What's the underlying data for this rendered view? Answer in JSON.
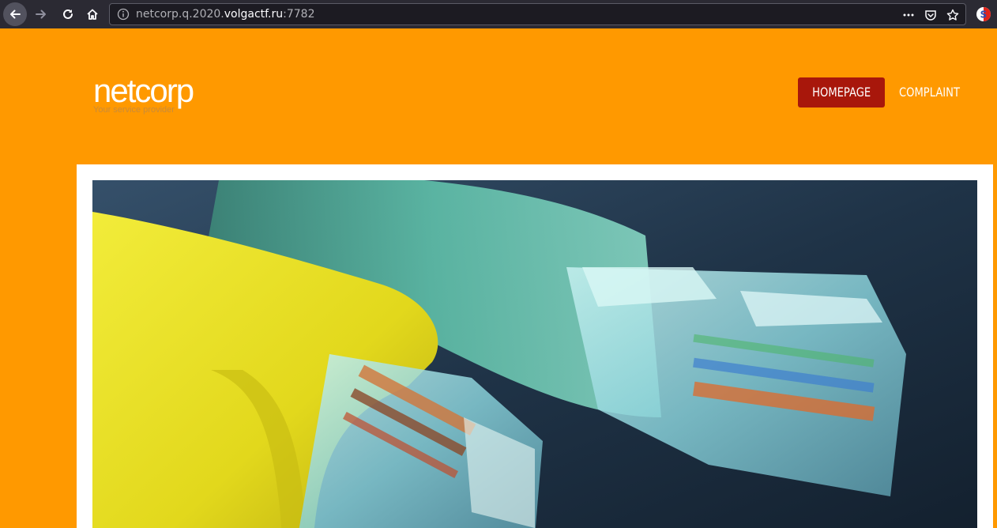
{
  "browser": {
    "url_prefix": "netcorp.q.2020.",
    "url_domain": "volgactf.ru",
    "url_suffix": ":7782",
    "icons": [
      "back-icon",
      "forward-icon",
      "reload-icon",
      "home-icon",
      "info-icon",
      "more-icon",
      "pocket-icon",
      "star-icon",
      "extension-icon"
    ]
  },
  "site": {
    "logo": "netcorp",
    "tagline": "Your service provider"
  },
  "nav": {
    "items": [
      {
        "label": "HOMEPAGE",
        "active": true
      },
      {
        "label": "COMPLAINT",
        "active": false
      }
    ]
  },
  "colors": {
    "page_bg": "#ff9900",
    "nav_active": "#a8170b",
    "content_bg": "#ffffff"
  },
  "hero": {
    "subject": "network-cables-photo"
  }
}
